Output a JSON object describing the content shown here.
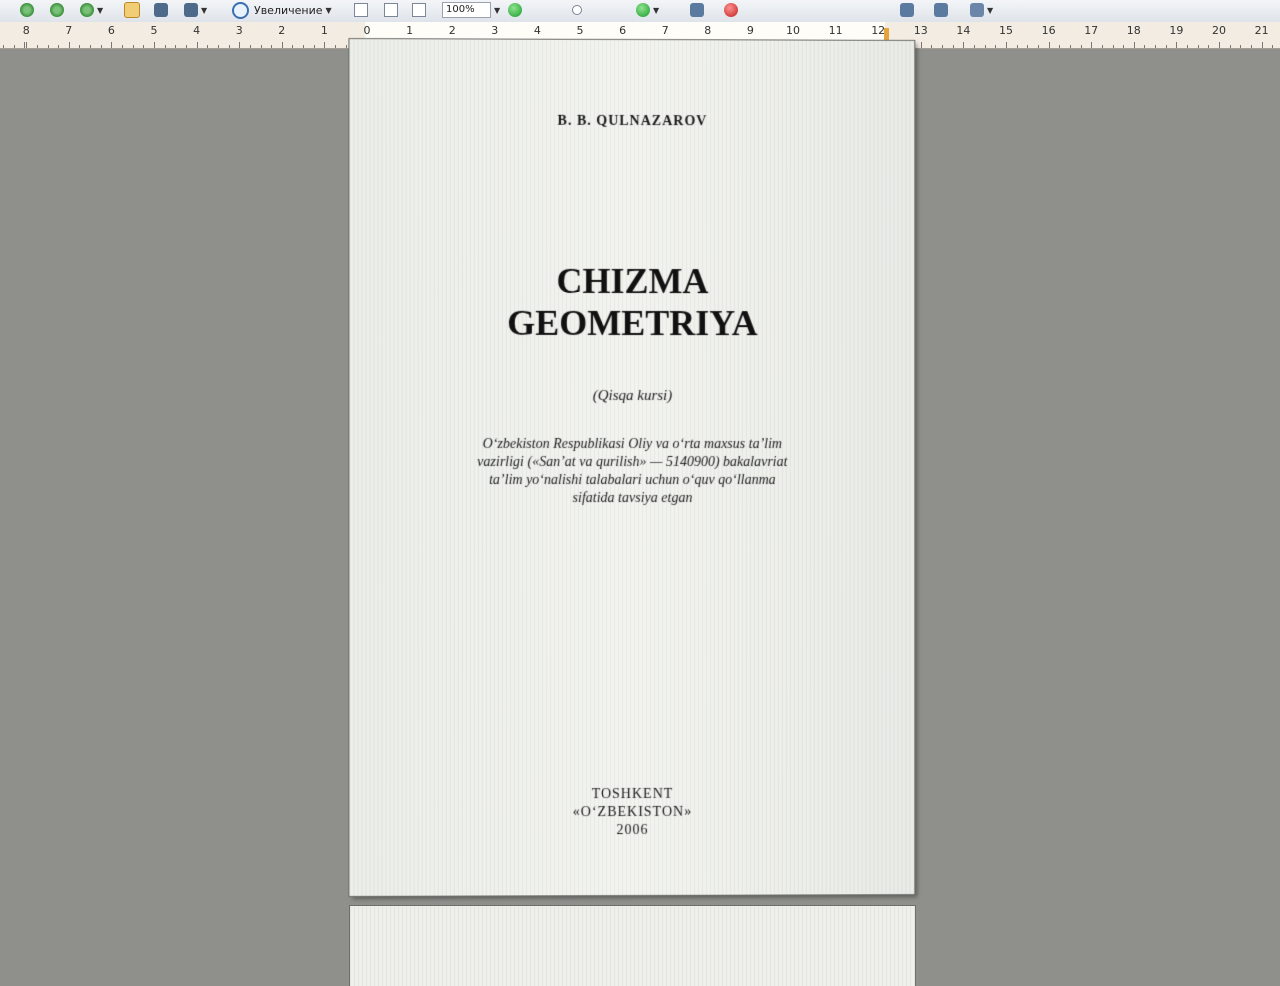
{
  "toolbar": {
    "zoom_tool_label": "Увеличение",
    "zoom_value": "100%"
  },
  "ruler": {
    "left_labels": [
      "8",
      "7",
      "6",
      "5",
      "4",
      "3",
      "2",
      "1"
    ],
    "right_labels": [
      "0",
      "1",
      "2",
      "3",
      "4",
      "5",
      "6",
      "7",
      "8",
      "9",
      "10",
      "11",
      "12",
      "13",
      "14",
      "15",
      "16",
      "17",
      "18",
      "19",
      "20",
      "21"
    ]
  },
  "document": {
    "author": "B. B. QULNAZAROV",
    "title_line1": "CHIZMA",
    "title_line2": "GEOMETRIYA",
    "subtitle": "(Qisqa kursi)",
    "description_lines": [
      "O‘zbekiston Respublikasi Oliy va o‘rta maxsus ta’lim",
      "vazirligi («San’at va qurilish» — 5140900) bakalavriat",
      "ta’lim yo‘nalishi talabalari uchun o‘quv qo‘llanma",
      "sifatida tavsiya etgan"
    ],
    "publisher_city": "TOSHKENT",
    "publisher_name": "«O‘ZBEKISTON»",
    "year": "2006"
  }
}
